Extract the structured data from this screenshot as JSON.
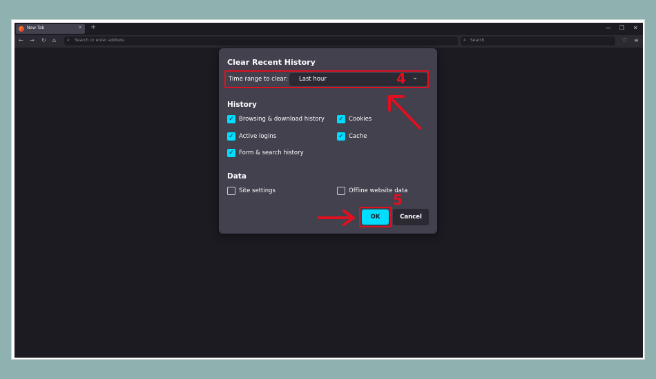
{
  "browser": {
    "tab_title": "New Tab",
    "url_placeholder": "Search or enter address",
    "search_placeholder": "Search"
  },
  "dialog": {
    "title": "Clear Recent History",
    "time_range_label": "Time range to clear:",
    "time_range_value": "Last hour",
    "history_heading": "History",
    "history_items": [
      {
        "label": "Browsing & download history",
        "checked": true
      },
      {
        "label": "Cookies",
        "checked": true
      },
      {
        "label": "Active logins",
        "checked": true
      },
      {
        "label": "Cache",
        "checked": true
      },
      {
        "label": "Form & search history",
        "checked": true
      }
    ],
    "data_heading": "Data",
    "data_items": [
      {
        "label": "Site settings",
        "checked": false
      },
      {
        "label": "Offline website data",
        "checked": false
      }
    ],
    "ok_label": "OK",
    "cancel_label": "Cancel"
  },
  "annotations": {
    "step4": "4",
    "step5": "5",
    "color": "#e01020"
  },
  "colors": {
    "accent": "#00ddff",
    "dialog_bg": "#42414d",
    "window_bg": "#1c1b22"
  }
}
